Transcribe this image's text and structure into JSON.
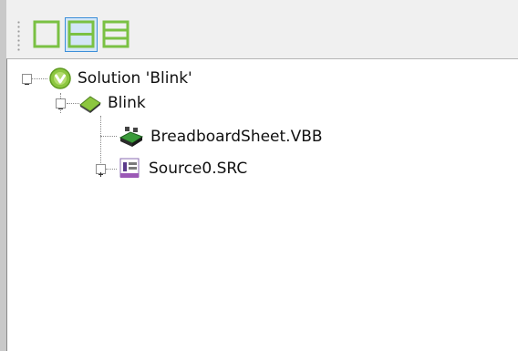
{
  "toolbar": {
    "buttons": [
      {
        "name": "single-pane-view",
        "icon": "square-icon",
        "active": false
      },
      {
        "name": "split-horizontal-view",
        "icon": "split-horizontal-icon",
        "active": true
      },
      {
        "name": "split-three-view",
        "icon": "split-three-icon",
        "active": false
      }
    ]
  },
  "tree": {
    "solution": {
      "label": "Solution 'Blink'",
      "expanded": true
    },
    "project": {
      "label": "Blink",
      "expanded": true
    },
    "items": [
      {
        "label": "BreadboardSheet.VBB",
        "has_children": false
      },
      {
        "label": "Source0.SRC",
        "has_children": true,
        "expanded": false
      }
    ]
  },
  "colors": {
    "toolbar_icon_green": "#7ac143",
    "active_button_border": "#3c8fd9",
    "active_button_fill": "#d3e6f7"
  }
}
